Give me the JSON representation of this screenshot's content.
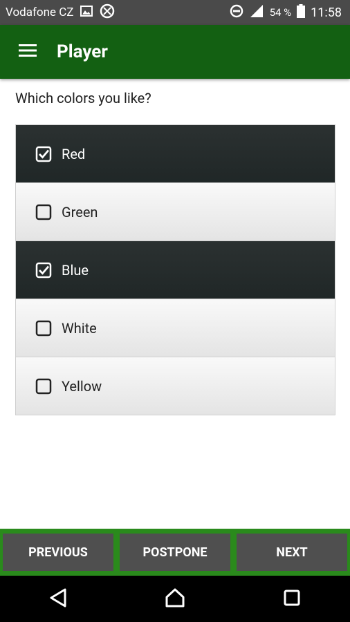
{
  "status_bar": {
    "carrier": "Vodafone CZ",
    "battery_percent": "54 %",
    "time": "11:58",
    "icons": [
      "image-icon",
      "data-saver-icon",
      "do-not-disturb-icon",
      "signal-icon",
      "battery-icon"
    ]
  },
  "app_bar": {
    "title": "Player",
    "menu_icon": "hamburger-menu-icon",
    "background": "#136012"
  },
  "question": "Which colors you like?",
  "options": [
    {
      "label": "Red",
      "checked": true
    },
    {
      "label": "Green",
      "checked": false
    },
    {
      "label": "Blue",
      "checked": true
    },
    {
      "label": "White",
      "checked": false
    },
    {
      "label": "Yellow",
      "checked": false
    }
  ],
  "buttons": {
    "previous": "PREVIOUS",
    "postpone": "POSTPONE",
    "next": "NEXT"
  },
  "colors": {
    "accent_green": "#136012",
    "bottom_bar_green": "#2a8a1c",
    "selected_row": "#232a2a"
  },
  "nav_bar": {
    "icons": [
      "back-icon",
      "home-icon",
      "recents-icon"
    ]
  }
}
